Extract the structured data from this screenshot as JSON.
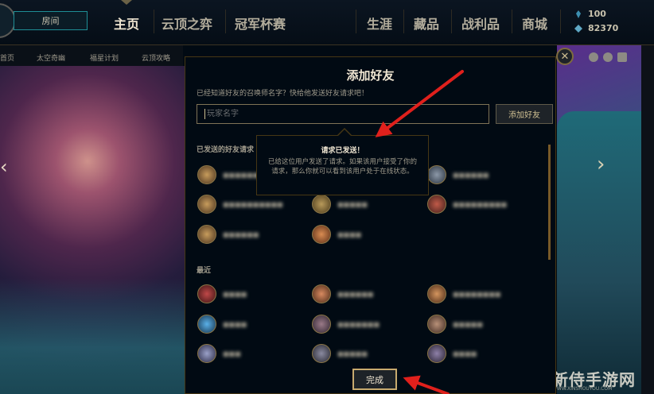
{
  "topbar": {
    "party_button": "房间",
    "nav": [
      {
        "label": "主页",
        "active": true
      },
      {
        "label": "云顶之弈",
        "active": false
      },
      {
        "label": "冠军杯赛",
        "active": false
      },
      {
        "label": "生涯",
        "active": false
      },
      {
        "label": "藏品",
        "active": false
      },
      {
        "label": "战利品",
        "active": false
      },
      {
        "label": "商城",
        "active": false
      }
    ],
    "blue_essence": "100",
    "riot_points": "82370"
  },
  "subnav": [
    "首页",
    "太空奇幽",
    "福星计划",
    "云顶攻略"
  ],
  "modal": {
    "title": "添加好友",
    "description": "已经知道好友的召唤师名字？快给他发送好友请求吧！",
    "input_placeholder": "玩家名字",
    "add_button": "添加好友",
    "sent_header": "已发送的好友请求",
    "recent_header": "最近",
    "done_button": "完成",
    "close_icon": "close-icon"
  },
  "tooltip": {
    "title": "请求已发送！",
    "body": "已给这位用户发送了请求。如果该用户接受了你的请求，那么你就可以看到该用户处于在线状态。"
  },
  "watermark": {
    "text": "新侍手游网",
    "sub": "WWW.XINSHOUYOU.COM"
  },
  "colors": {
    "gold": "#c8aa6e",
    "arrow_red": "#e0201c",
    "bg": "#010a13"
  }
}
